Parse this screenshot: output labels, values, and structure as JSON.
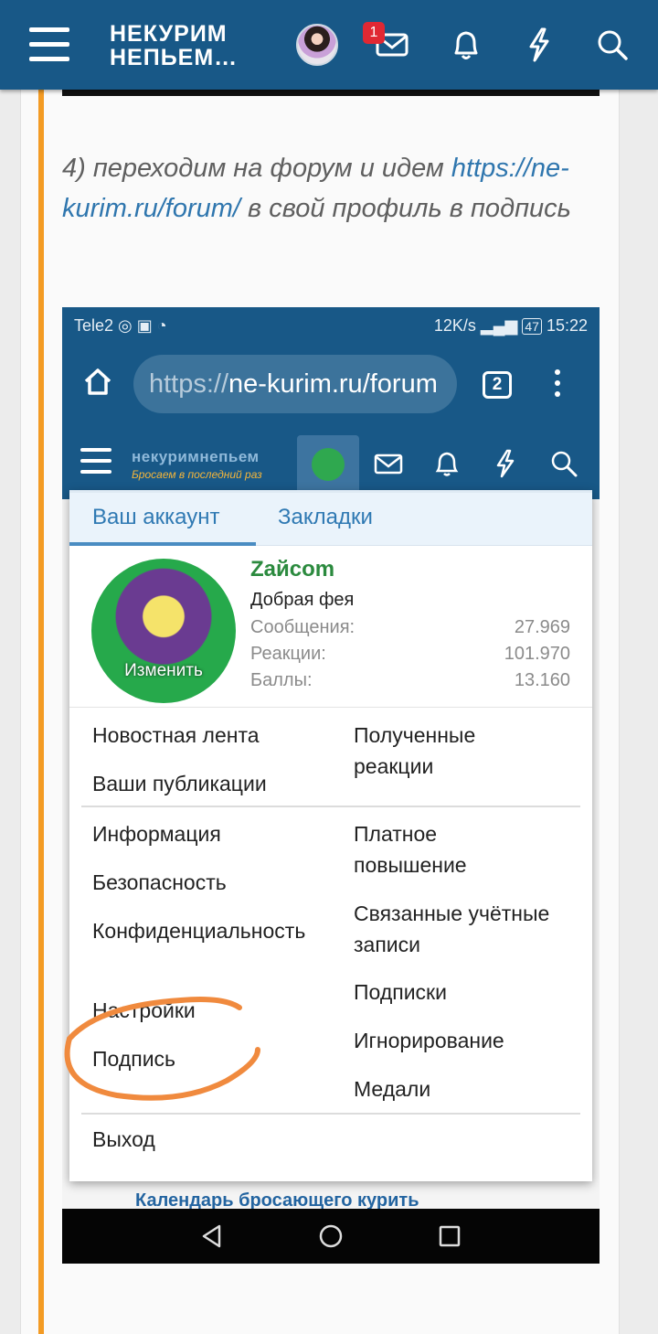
{
  "header": {
    "logo_line1": "НЕКУРИМ",
    "logo_line2": "НЕПЬЕМ…",
    "notification_count": "1",
    "icons": [
      "menu-icon",
      "avatar",
      "mail-icon",
      "bell-icon",
      "bolt-icon",
      "search-icon"
    ]
  },
  "instruction": {
    "before": "4) переходим на форум и идем ",
    "link": "https://ne-kurim.ru/forum/",
    "after": " в свой профиль в подпись"
  },
  "screenshot": {
    "status_left": "Tele2",
    "status_right": "12K/s",
    "battery": "47",
    "time": "15:22",
    "url_scheme": "https://",
    "url_rest": "ne-kurim.ru/forum",
    "tabs_count": "2",
    "inner_logo_title": "некуримнепьем",
    "inner_logo_tagline": "Бросаем в последний раз",
    "menu": {
      "tabs": [
        "Ваш аккаунт",
        "Закладки"
      ],
      "avatar_edit": "Изменить",
      "username": "Zайсоm",
      "user_title": "Добрая фея",
      "stats": [
        {
          "label": "Сообщения:",
          "value": "27.969"
        },
        {
          "label": "Реакции:",
          "value": "101.970"
        },
        {
          "label": "Баллы:",
          "value": "13.160"
        }
      ],
      "left_col_1": [
        "Новостная лента",
        "Ваши публикации"
      ],
      "right_col_1": [
        "Полученные реакции"
      ],
      "left_col_2": [
        "Информация",
        "Безопасность",
        "Конфиденциальность",
        "Настройки",
        "Подпись"
      ],
      "right_col_2": [
        "Платное повышение",
        "Связанные учётные записи",
        "Подписки",
        "Игнорирование",
        "Медали"
      ],
      "logout": "Выход"
    },
    "bg_list_fragment": "Календарь бросающего курить",
    "highlight_color": "#f08a3e"
  },
  "colors": {
    "header_bg": "#185887",
    "accent_orange": "#f39b24",
    "link_blue": "#2f76ae",
    "badge_red": "#e02833",
    "username_green": "#2b8a3e"
  }
}
